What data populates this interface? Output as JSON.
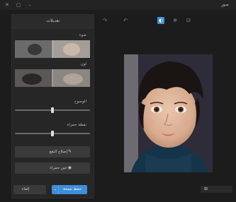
{
  "window": {
    "title": "صور"
  },
  "panel": {
    "title": "تعديلات",
    "section_light": "ضوء",
    "section_color": "لون",
    "slider_contrast_label": "الوضوح",
    "slider_vignette_label": "نقطة حمراء",
    "contrast_value": 0.5,
    "vignette_value": 0.5,
    "button_spot_fix": "إصلاح البقع",
    "button_red_eye": "عين حمراء",
    "save_copy_label": "حفظ نسخة",
    "cancel_label": "إلغاء"
  },
  "status": {
    "zoom_label": "⊞"
  },
  "icons": [
    "minimize-icon",
    "maximize-icon",
    "undo-icon",
    "redo-icon",
    "crop-icon",
    "filter-icon",
    "adjust-icon"
  ],
  "colors": {
    "accent": "#3d8fd8",
    "background": "#1c1c1c"
  }
}
